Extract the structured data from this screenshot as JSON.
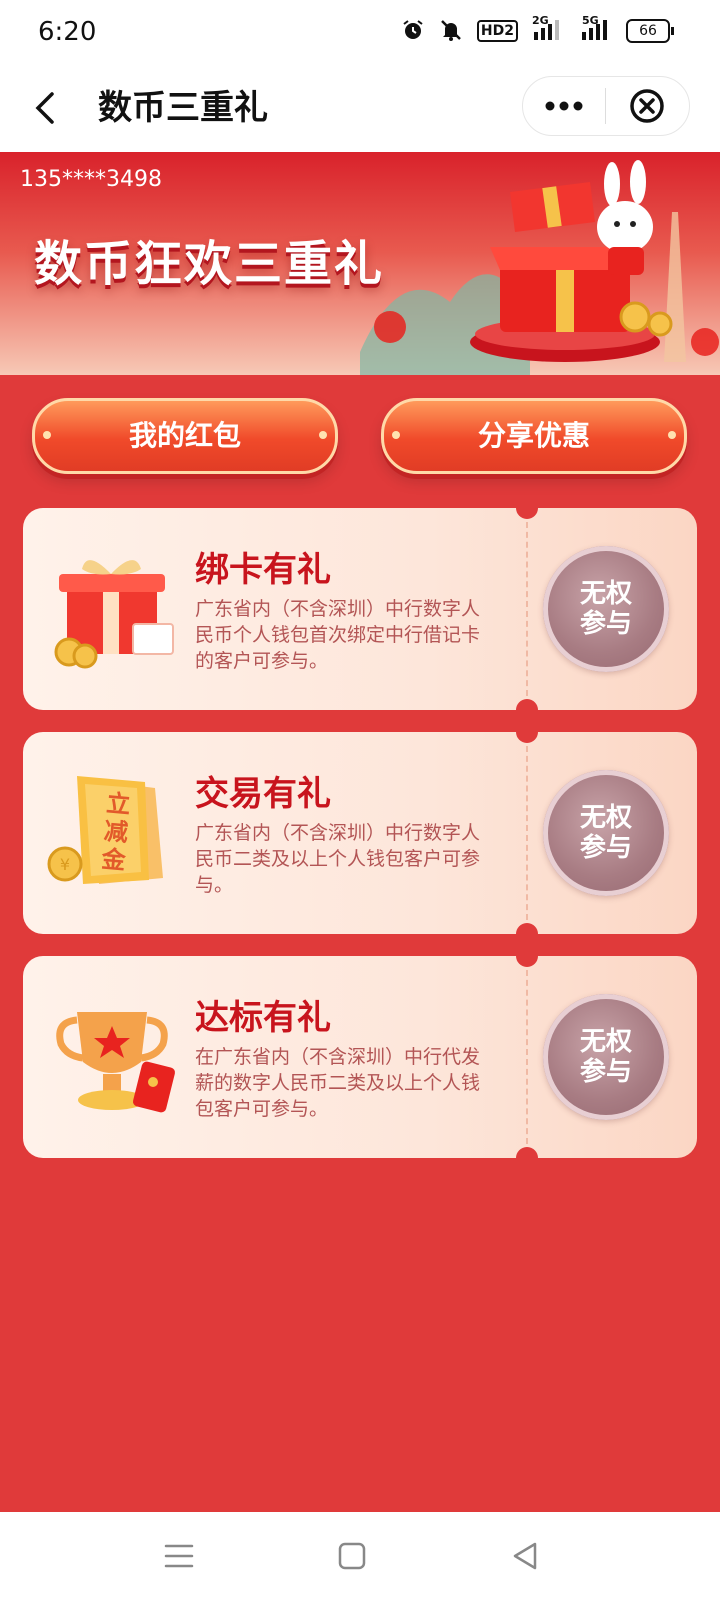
{
  "status_bar": {
    "time": "6:20",
    "hd": "HD2",
    "net1": "2G",
    "net2": "5G",
    "battery": "66"
  },
  "title_bar": {
    "title": "数币三重礼"
  },
  "banner": {
    "phone": "135****3498",
    "title": "数币狂欢三重礼"
  },
  "actions": {
    "my_red_packet": "我的红包",
    "share": "分享优惠"
  },
  "cards": [
    {
      "title": "绑卡有礼",
      "desc": "广东省内（不含深圳）中行数字人民币个人钱包首次绑定中行借记卡的客户可参与。",
      "button_line1": "无权",
      "button_line2": "参与"
    },
    {
      "title": "交易有礼",
      "desc": "广东省内（不含深圳）中行数字人民币二类及以上个人钱包客户可参与。",
      "button_line1": "无权",
      "button_line2": "参与",
      "icon_text": "立减金"
    },
    {
      "title": "达标有礼",
      "desc": "在广东省内（不含深圳）中行代发薪的数字人民币二类及以上个人钱包客户可参与。",
      "button_line1": "无权",
      "button_line2": "参与"
    }
  ],
  "colors": {
    "page_bg": "#e03a3a",
    "title_red": "#c8141d",
    "button_gray": "#a87c83"
  }
}
